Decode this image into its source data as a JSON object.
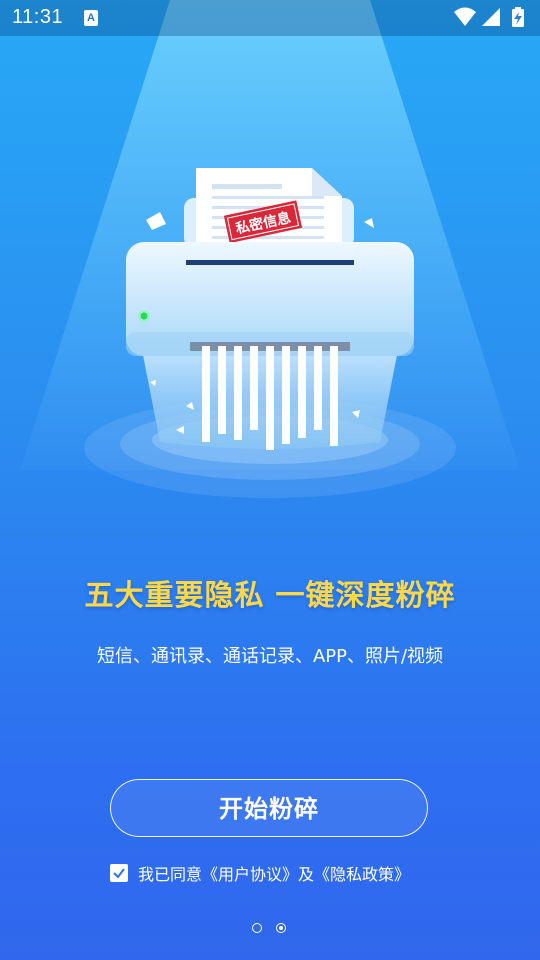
{
  "status_bar": {
    "time": "11:31",
    "notification_icon_letter": "A",
    "icons": [
      "wifi-icon",
      "signal-icon",
      "battery-charging-icon"
    ]
  },
  "illustration": {
    "stamp_text": "私密信息",
    "led_color": "#22e04a"
  },
  "headline": "五大重要隐私 一键深度粉碎",
  "subline": "短信、通讯录、通话记录、APP、照片/视频",
  "start_button_label": "开始粉碎",
  "agreement": {
    "checked": true,
    "text": "我已同意《用户协议》及《隐私政策》"
  },
  "pager": {
    "total": 2,
    "current": 2
  },
  "colors": {
    "headline": "#ffd84a",
    "stamp": "#d8283a",
    "background_top": "#27a9f6",
    "background_bottom": "#3167ec"
  }
}
